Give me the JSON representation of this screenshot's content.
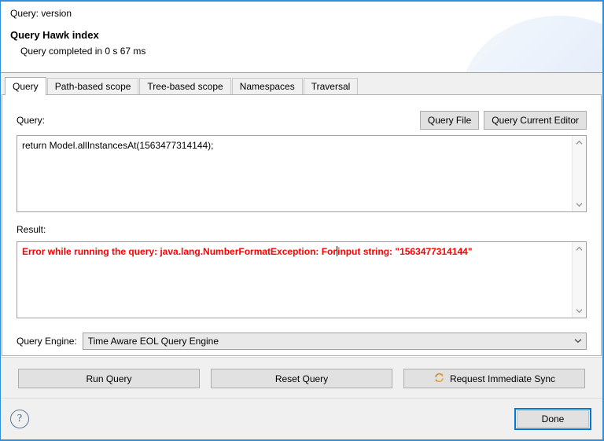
{
  "banner": {
    "subtitle": "Query: version",
    "title": "Query Hawk index",
    "status": "Query completed in 0 s 67 ms"
  },
  "tabs": [
    {
      "label": "Query",
      "active": true
    },
    {
      "label": "Path-based scope",
      "active": false
    },
    {
      "label": "Tree-based scope",
      "active": false
    },
    {
      "label": "Namespaces",
      "active": false
    },
    {
      "label": "Traversal",
      "active": false
    }
  ],
  "query_section": {
    "label": "Query:",
    "query_file_button": "Query File",
    "query_current_editor_button": "Query Current Editor",
    "value": "return Model.allInstancesAt(1563477314144);",
    "placeholder": ""
  },
  "result_section": {
    "label": "Result:",
    "error_before_caret": "Error while running the query: java.lang.NumberFormatException: For",
    "error_after_caret": "input string: \"1563477314144\"",
    "error_color": "#ff0000"
  },
  "engine_section": {
    "label": "Query Engine:",
    "selected": "Time Aware EOL Query Engine",
    "options": [
      "Time Aware EOL Query Engine"
    ]
  },
  "action_buttons": {
    "run_query": "Run Query",
    "reset_query": "Reset Query",
    "request_sync": "Request Immediate Sync"
  },
  "footer": {
    "help_glyph": "?",
    "done_button": "Done"
  },
  "icons": {
    "scroll_up": "▲",
    "scroll_down": "▼",
    "combo_chevron": "▼"
  },
  "colors": {
    "accent_blue": "#0078d7",
    "dialog_border": "#2f8fd8",
    "error_red": "#ff0000",
    "sync_gold": "#e8a33d"
  }
}
